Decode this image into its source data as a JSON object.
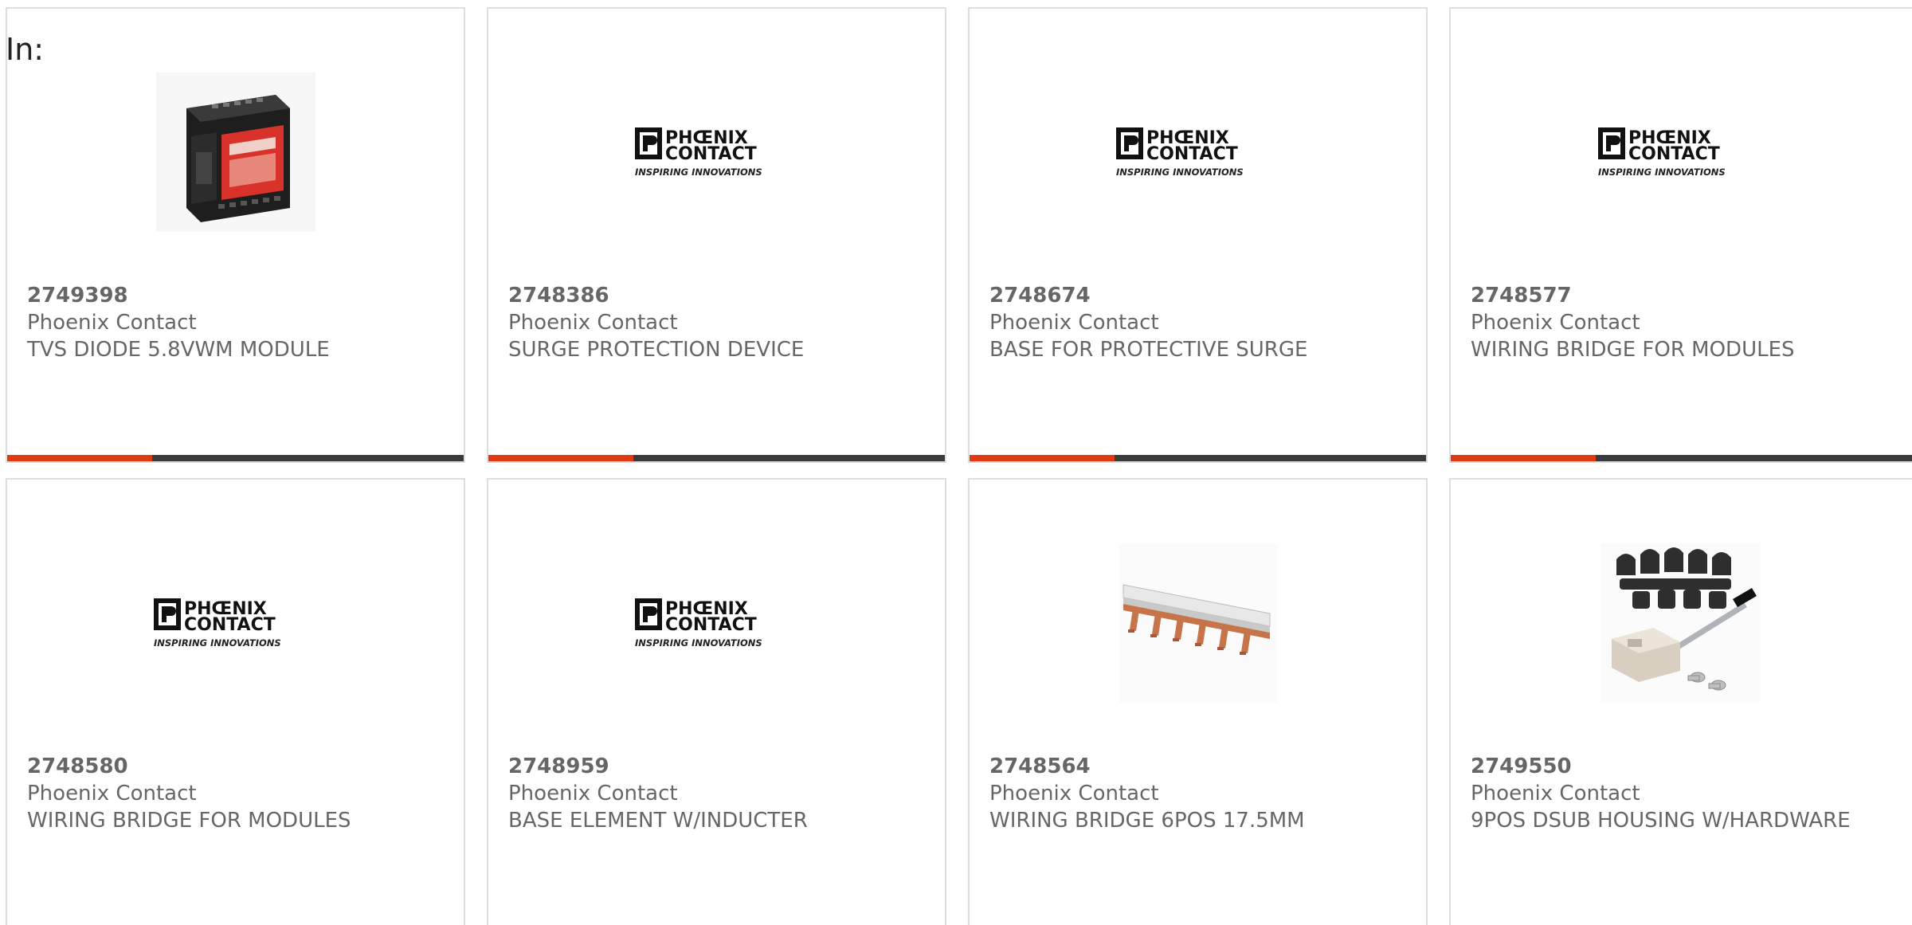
{
  "page": {
    "in_label": "In:"
  },
  "colors": {
    "accent_bar": "#e03a10",
    "dark_bar": "#3a3a3a",
    "text": "#666666",
    "card_border": "#dedede"
  },
  "products": [
    {
      "part_number": "2749398",
      "manufacturer": "Phoenix Contact",
      "description": "TVS DIODE 5.8VWM MODULE",
      "image": "surge-module-image",
      "has_bar": true
    },
    {
      "part_number": "2748386",
      "manufacturer": "Phoenix Contact",
      "description": "SURGE PROTECTION DEVICE",
      "image": "phoenix-contact-logo",
      "has_bar": true
    },
    {
      "part_number": "2748674",
      "manufacturer": "Phoenix Contact",
      "description": "BASE FOR PROTECTIVE SURGE",
      "image": "phoenix-contact-logo",
      "has_bar": true
    },
    {
      "part_number": "2748577",
      "manufacturer": "Phoenix Contact",
      "description": "WIRING BRIDGE FOR MODULES",
      "image": "phoenix-contact-logo",
      "has_bar": true
    },
    {
      "part_number": "2748580",
      "manufacturer": "Phoenix Contact",
      "description": "WIRING BRIDGE FOR MODULES",
      "image": "phoenix-contact-logo",
      "has_bar": false
    },
    {
      "part_number": "2748959",
      "manufacturer": "Phoenix Contact",
      "description": "BASE ELEMENT W/INDUCTER",
      "image": "phoenix-contact-logo",
      "has_bar": false
    },
    {
      "part_number": "2748564",
      "manufacturer": "Phoenix Contact",
      "description": "WIRING BRIDGE 6POS 17.5MM",
      "image": "wiring-bridge-image",
      "has_bar": false
    },
    {
      "part_number": "2749550",
      "manufacturer": "Phoenix Contact",
      "description": "9POS DSUB HOUSING W/HARDWARE",
      "image": "dsub-housing-image",
      "has_bar": false
    }
  ],
  "logo": {
    "line1": "PHŒNIX",
    "line2": "CONTACT",
    "tagline": "INSPIRING INNOVATIONS"
  }
}
